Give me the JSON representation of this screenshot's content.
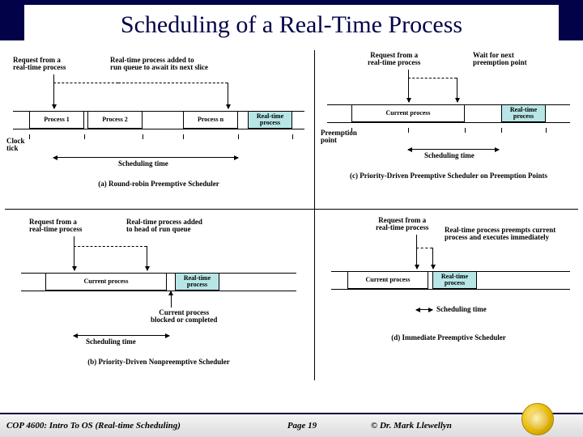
{
  "title": "Scheduling of a Real-Time Process",
  "footer": {
    "course": "COP 4600: Intro To OS  (Real-time Scheduling)",
    "page": "Page 19",
    "author": "© Dr. Mark Llewellyn"
  },
  "panels": {
    "a": {
      "caption": "(a) Round-robin Preemptive Scheduler",
      "req": "Request from a\nreal-time process",
      "added": "Real-time process added to\nrun queue to await its next slice",
      "p1": "Process 1",
      "p2": "Process 2",
      "pn": "Process n",
      "rt": "Real-time\nprocess",
      "clock": "Clock\ntick",
      "sched": "Scheduling time"
    },
    "b": {
      "caption": "(b) Priority-Driven Nonpreemptive Scheduler",
      "req": "Request from a\nreal-time process",
      "added": "Real-time process added\nto head of run queue",
      "cur": "Current process",
      "rt": "Real-time\nprocess",
      "blocked": "Current process\nblocked or completed",
      "sched": "Scheduling time"
    },
    "c": {
      "caption": "(c) Priority-Driven Preemptive Scheduler on Preemption Points",
      "req": "Request from a\nreal-time process",
      "wait": "Wait for next\npreemption point",
      "cur": "Current process",
      "rt": "Real-time\nprocess",
      "preempt": "Preemption\npoint",
      "sched": "Scheduling time"
    },
    "d": {
      "caption": "(d) Immediate Preemptive Scheduler",
      "req": "Request from a\nreal-time process",
      "preempts": "Real-time process preempts current\nprocess and executes immediately",
      "cur": "Current process",
      "rt": "Real-time\nprocess",
      "sched": "Scheduling time"
    }
  }
}
